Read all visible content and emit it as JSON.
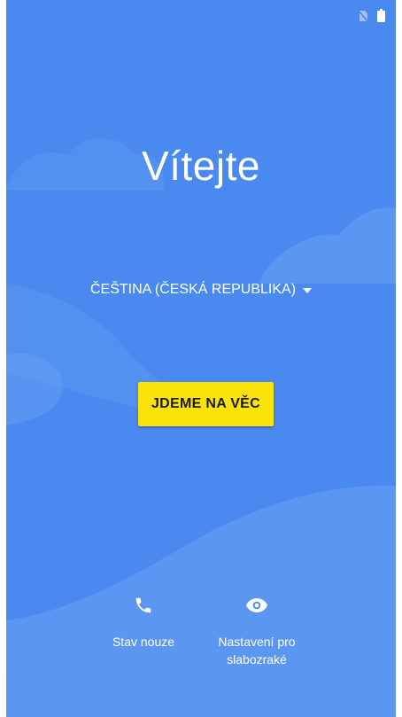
{
  "status_bar": {
    "icons": [
      "no-sim-icon",
      "battery-icon"
    ]
  },
  "welcome": {
    "title": "Vítejte"
  },
  "language": {
    "selected": "ČEŠTINA (ČESKÁ REPUBLIKA)",
    "icon": "dropdown-arrow-icon"
  },
  "start_button": {
    "label": "JDEME NA VĚC"
  },
  "bottom_actions": {
    "emergency": {
      "label": "Stav nouze",
      "icon": "phone-icon"
    },
    "accessibility": {
      "label_line1": "Nastavení pro",
      "label_line2": "slabozraké",
      "icon": "eye-icon"
    }
  },
  "colors": {
    "background": "#4a8af0",
    "button": "#fbe20a",
    "text": "#ffffff"
  }
}
